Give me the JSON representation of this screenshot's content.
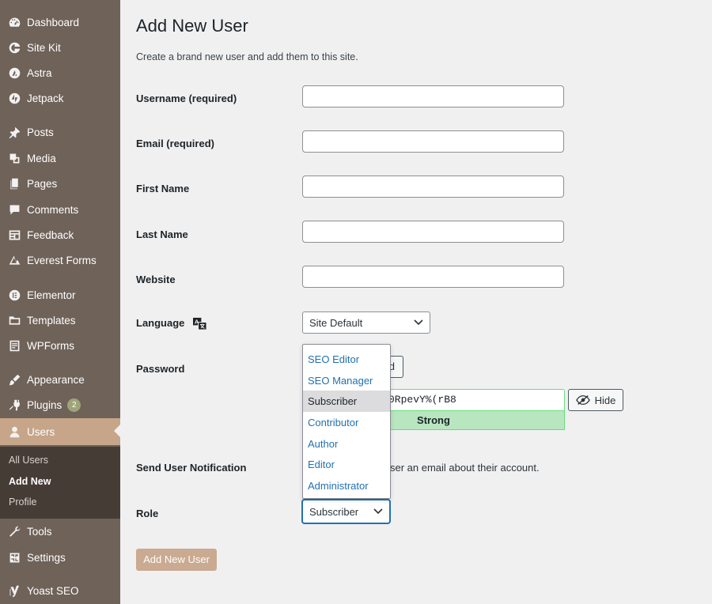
{
  "sidebar": {
    "menu": [
      {
        "icon": "dashboard-icon",
        "label": "Dashboard"
      },
      {
        "icon": "site-kit-icon",
        "label": "Site Kit"
      },
      {
        "icon": "astra-icon",
        "label": "Astra"
      },
      {
        "icon": "jetpack-icon",
        "label": "Jetpack"
      },
      {
        "icon": "posts-pin-icon",
        "label": "Posts"
      },
      {
        "icon": "media-icon",
        "label": "Media"
      },
      {
        "icon": "pages-icon",
        "label": "Pages"
      },
      {
        "icon": "comments-icon",
        "label": "Comments"
      },
      {
        "icon": "feedback-icon",
        "label": "Feedback"
      },
      {
        "icon": "everest-forms-icon",
        "label": "Everest Forms"
      },
      {
        "icon": "elementor-icon",
        "label": "Elementor"
      },
      {
        "icon": "templates-folder-icon",
        "label": "Templates"
      },
      {
        "icon": "wpforms-icon",
        "label": "WPForms"
      },
      {
        "icon": "appearance-brush-icon",
        "label": "Appearance"
      },
      {
        "icon": "plugins-icon",
        "label": "Plugins",
        "badge": "2"
      },
      {
        "icon": "users-icon",
        "label": "Users"
      },
      {
        "icon": "tools-icon",
        "label": "Tools"
      },
      {
        "icon": "settings-icon",
        "label": "Settings"
      },
      {
        "icon": "yoast-icon",
        "label": "Yoast SEO"
      }
    ],
    "submenu": [
      {
        "label": "All Users"
      },
      {
        "label": "Add New"
      },
      {
        "label": "Profile"
      }
    ]
  },
  "page": {
    "title": "Add New User",
    "description": "Create a brand new user and add them to this site."
  },
  "form": {
    "username_label": "Username (required)",
    "email_label": "Email (required)",
    "first_name_label": "First Name",
    "last_name_label": "Last Name",
    "website_label": "Website",
    "language_label": "Language",
    "language_value": "Site Default",
    "password_label": "Password",
    "password_button_visible": "d",
    "password_value_visible": "0RpevY%(rB8",
    "password_strength": "Strong",
    "hide_label": "Hide",
    "notification_label": "Send User Notification",
    "notification_text_visible": "ser an email about their account.",
    "role_label": "Role",
    "role_value": "Subscriber",
    "role_options": [
      "SEO Editor",
      "SEO Manager",
      "Subscriber",
      "Contributor",
      "Author",
      "Editor",
      "Administrator"
    ],
    "role_selected_index": 2,
    "submit_label": "Add New User"
  },
  "colors": {
    "sidebar_bg": "#6f6259",
    "submenu_bg": "#463c36",
    "accent": "#c7a589",
    "strength_bg": "#b8e6bf",
    "strength_border": "#68de7c",
    "link": "#2271b1"
  }
}
